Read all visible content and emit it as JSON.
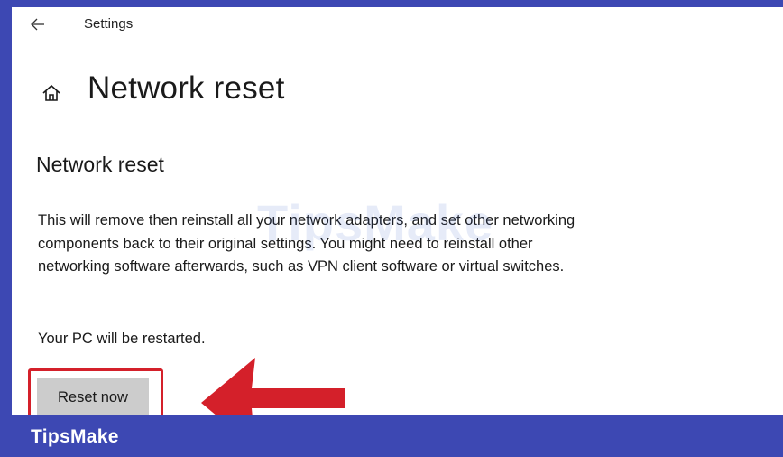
{
  "window": {
    "app_title": "Settings"
  },
  "page": {
    "title": "Network reset"
  },
  "section": {
    "heading": "Network reset",
    "description": "This will remove then reinstall all your network adapters, and set other networking components back to their original settings. You might need to reinstall other networking software afterwards, such as VPN client software or virtual switches.",
    "restart_note": "Your PC will be restarted.",
    "reset_button_label": "Reset now"
  },
  "watermark": {
    "text": "TipsMake"
  },
  "footer": {
    "brand": "TipsMake"
  },
  "icons": {
    "back": "back-arrow-icon",
    "home": "home-icon",
    "annotation": "red-arrow-icon"
  },
  "colors": {
    "frame": "#3d48b3",
    "highlight": "#d4202a",
    "button_bg": "#cccccc"
  }
}
